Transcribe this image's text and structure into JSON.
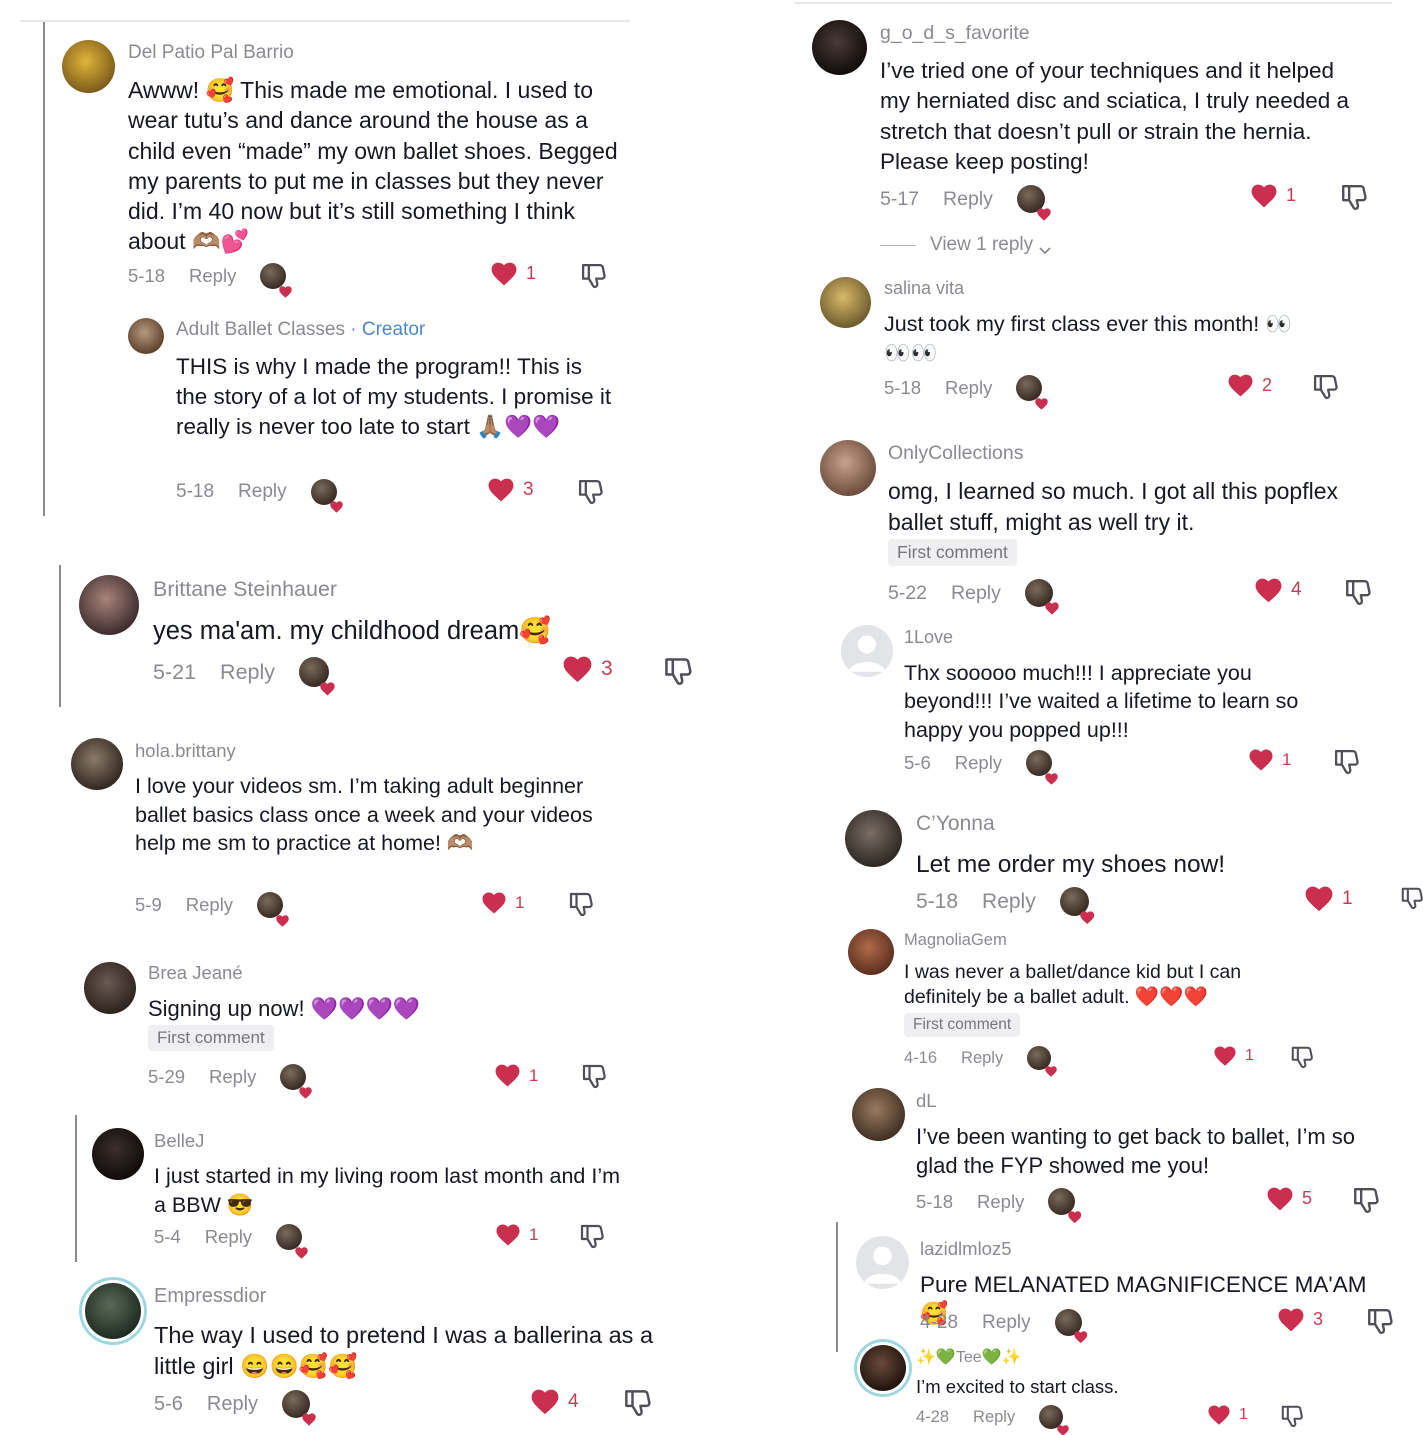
{
  "comments": [
    {
      "name": "Del Patio Pal Barrio",
      "text": "Awww! 🥰 This made me emotional. I used to wear tutu’s and dance around the house as a child even “made” my own ballet shoes. Begged my parents to put me in classes but they never did. I’m 40 now but it’s still something I think about 🫶🏽💕",
      "date": "5-18",
      "reply": "Reply",
      "likes": "1"
    },
    {
      "name": "Adult Ballet Classes",
      "creator": "· Creator",
      "text": "THIS is why I made the program!! This is the story of a lot of my students. I promise it really is never too late to start 🙏🏽💜💜",
      "date": "5-18",
      "reply": "Reply",
      "likes": "3"
    },
    {
      "name": "Brittane Steinhauer",
      "text": "yes ma'am. my childhood dream🥰",
      "date": "5-21",
      "reply": "Reply",
      "likes": "3"
    },
    {
      "name": "hola.brittany",
      "text": "I love your videos sm. I’m taking adult beginner ballet basics class once a week and your videos help me sm to practice at home! 🫶🏽",
      "date": "5-9",
      "reply": "Reply",
      "likes": "1"
    },
    {
      "name": "Brea Jeané",
      "text": "Signing up now! 💜💜💜💜",
      "badge": "First comment",
      "date": "5-29",
      "reply": "Reply",
      "likes": "1"
    },
    {
      "name": "BelleJ",
      "text": "I just started in my living room last month and I’m a BBW 😎",
      "date": "5-4",
      "reply": "Reply",
      "likes": "1"
    },
    {
      "name": "Empressdior",
      "text": "The way I used to pretend I was a ballerina as a little girl 😄😄🥰🥰",
      "date": "5-6",
      "reply": "Reply",
      "likes": "4"
    },
    {
      "name": "g_o_d_s_favorite",
      "text": "I’ve tried one of your techniques and it helped my herniated disc and sciatica, I truly needed a stretch that doesn’t pull or strain the hernia. Please keep posting!",
      "date": "5-17",
      "reply": "Reply",
      "likes": "1",
      "view_replies": "View 1 reply"
    },
    {
      "name": "salina vita",
      "text": "Just took my first class ever this month! 👀 👀👀",
      "date": "5-18",
      "reply": "Reply",
      "likes": "2"
    },
    {
      "name": "OnlyCollections",
      "text": "omg, I learned so much. I got all this popflex ballet stuff, might as well try it.",
      "badge": "First comment",
      "date": "5-22",
      "reply": "Reply",
      "likes": "4"
    },
    {
      "name": "1Love",
      "text": "Thx sooooo much!!! I appreciate you beyond!!! I’ve waited a lifetime to learn so happy you popped up!!!",
      "date": "5-6",
      "reply": "Reply",
      "likes": "1"
    },
    {
      "name": "C’Yonna",
      "text": "Let me order my shoes now!",
      "date": "5-18",
      "reply": "Reply",
      "likes": "1"
    },
    {
      "name": "MagnoliaGem",
      "text": "I was never a ballet/dance kid but I can definitely be a ballet adult. ❤️❤️❤️",
      "badge": "First comment",
      "date": "4-16",
      "reply": "Reply",
      "likes": "1"
    },
    {
      "name": "dL",
      "text": "I’ve been wanting to get back to ballet, I’m so glad the FYP showed me you!",
      "date": "5-18",
      "reply": "Reply",
      "likes": "5"
    },
    {
      "name": "lazidlmloz5",
      "text": "Pure MELANATED MAGNIFICENCE MA'AM 🥰",
      "date": "4-28",
      "reply": "Reply",
      "likes": "3"
    },
    {
      "name": "✨💚Tee💚✨",
      "text": "I’m excited to start class.",
      "date": "4-28",
      "reply": "Reply",
      "likes": "1"
    }
  ]
}
